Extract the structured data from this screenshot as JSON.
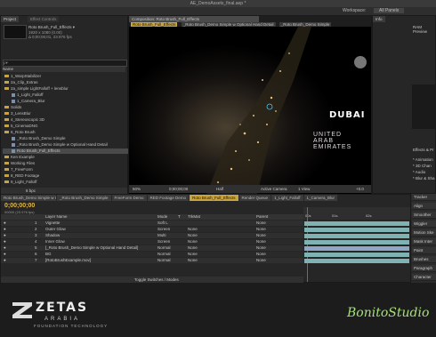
{
  "window": {
    "title": "AE_DemoAssets_final.aep *",
    "workspace_label": "Workspace:",
    "workspace_value": "All Panels"
  },
  "menu": [
    "Project",
    "Effect Controls",
    "Composition: Roto Brush_Full_Effects",
    "Layer: (none)",
    "Footage: (none)",
    "Flowchart: (none)",
    "Info",
    "Audio"
  ],
  "project": {
    "tab": "Project",
    "effect_tab": "Effect Controls",
    "selected_name": "Roto Brush_Full_Effects ▾",
    "selected_meta_1": "1920 x 1080 (0.00)",
    "selected_meta_2": "Δ 0;00;06;01, 23.976 fps",
    "search_placeholder": "ρ▾",
    "column_name": "Name",
    "items": [
      {
        "label": "1_WarpStabilizer",
        "type": "folder"
      },
      {
        "label": "2a_Clip_Extras",
        "type": "folder"
      },
      {
        "label": "2a_simple LightFalloff + lensblur",
        "type": "folder"
      },
      {
        "label": "1_Light_Falloff",
        "type": "comp"
      },
      {
        "label": "1_Camera_Blur",
        "type": "comp"
      },
      {
        "label": "Solids",
        "type": "folder"
      },
      {
        "label": "3_LensBlur",
        "type": "folder"
      },
      {
        "label": "4_Stereoscopic 3D",
        "type": "folder"
      },
      {
        "label": "5_CinemaDNG",
        "type": "folder"
      },
      {
        "label": "6_Roto Brush",
        "type": "folder"
      },
      {
        "label": "_Roto Brush_Demo Simple",
        "type": "comp"
      },
      {
        "label": "_Roto Brush_Demo Simple w Optional Hand Detail",
        "type": "comp"
      },
      {
        "label": "Roto Brush_Full_Effects",
        "type": "comp",
        "selected": true
      },
      {
        "label": "Ken Example",
        "type": "folder"
      },
      {
        "label": "Working Files",
        "type": "folder"
      },
      {
        "label": "7_FreeForm",
        "type": "folder"
      },
      {
        "label": "8_RED Footage",
        "type": "folder"
      },
      {
        "label": "9_Light_Falloff",
        "type": "folder"
      }
    ],
    "bpc": "8 bpc"
  },
  "composition": {
    "tabs": [
      "Roto Brush_Full_Effects",
      "_Roto Brush_Demo Simple w Optional Hand Detail",
      "_Roto Brush_Demo Simple"
    ],
    "overlay_title": "DUBAI",
    "overlay_sub_1": "UNITED",
    "overlay_sub_2": "ARAB EMIRATES",
    "zoom": "50%",
    "timecode": "0;00;00;00",
    "resolution": "Half",
    "camera": "Active Camera",
    "view": "1 View",
    "offset": "+0.0"
  },
  "right_panel": {
    "info_tab": "Info",
    "audio_tab": "Audio",
    "effects_tab": "Effects & Pr",
    "preview_label": "RAM Preview",
    "fx_items": [
      "* Animation",
      "* 3D Chan",
      "* Audio",
      "* Blur & Sha"
    ],
    "panels": [
      "Tracker",
      "Align",
      "Smoother",
      "Wiggler",
      "Motion Ske",
      "Mask Inter",
      "Paint",
      "Brushes",
      "Paragraph",
      "Character"
    ]
  },
  "timeline": {
    "tabs": [
      "Roto Brush_Demo Simple w Optional Hand Detail",
      "_Roto Brush_Demo Simple",
      "FreeForm Demo",
      "RED Footage Demo",
      "Roto Brush_Full_Effects",
      "Render Queue",
      "1_Light_Falloff",
      "1_Camera_Blur"
    ],
    "timecode": "0;00;00;00",
    "frame_info": "00000 (23.976 fps)",
    "col_layer": "Layer Name",
    "col_mode": "Mode",
    "col_t": "T",
    "col_trkmat": "TrkMat",
    "col_parent": "Parent",
    "ruler": [
      "00s",
      "01s",
      "02s"
    ],
    "layers": [
      {
        "num": "1",
        "name": "Vignette",
        "mode": "Soft L",
        "trk": "",
        "parent": "None"
      },
      {
        "num": "2",
        "name": "Outer Glow",
        "mode": "Screen",
        "trk": "None",
        "parent": "None"
      },
      {
        "num": "3",
        "name": "Shadow",
        "mode": "Multi",
        "trk": "None",
        "parent": "None"
      },
      {
        "num": "4",
        "name": "Inner Glow",
        "mode": "Screen",
        "trk": "None",
        "parent": "None"
      },
      {
        "num": "5",
        "name": "[_Roto Brush_Demo Simple w Optional Hand Detail]",
        "mode": "Normal",
        "trk": "None",
        "parent": "None"
      },
      {
        "num": "6",
        "name": "BG",
        "mode": "Normal",
        "trk": "None",
        "parent": "None"
      },
      {
        "num": "7",
        "name": "[RotoBrushExample.mov]",
        "mode": "Normal",
        "trk": "None",
        "parent": "None"
      }
    ],
    "footer": "Toggle Switches / Modes"
  },
  "branding": {
    "left_logo": "ZETAS",
    "left_sub": "ARABIA",
    "left_tag": "FOUNDATION TECHNOLOGY",
    "right_logo": "BonitoStudio"
  },
  "colors": {
    "accent": "#c9a43c",
    "layer_bar": "#7fb3b3",
    "layer_bar2": "#8fa7c4",
    "playhead": "#d04040",
    "right_logo": "#a5e07a"
  }
}
